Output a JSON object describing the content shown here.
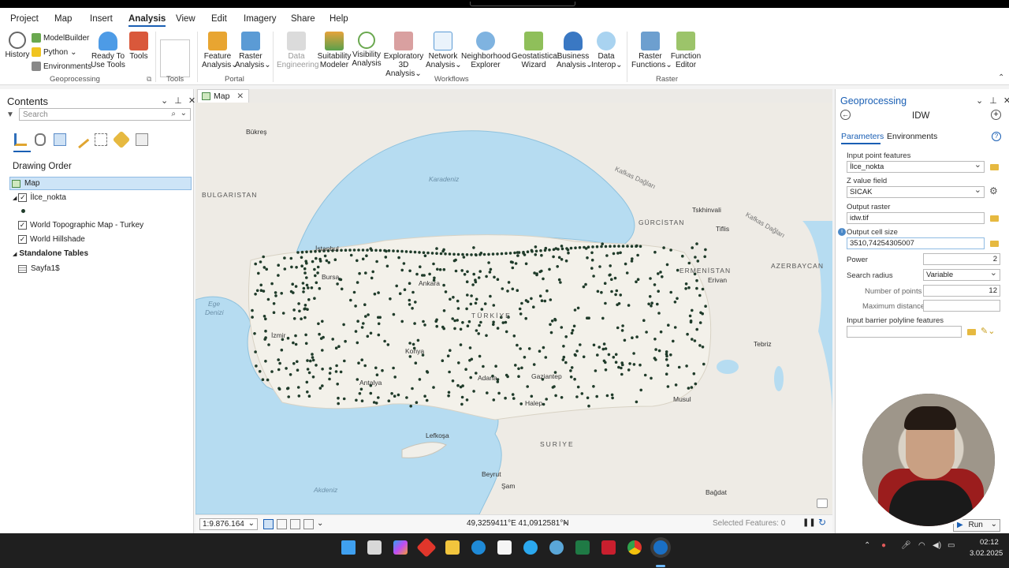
{
  "menu": [
    "Project",
    "Map",
    "Insert",
    "Analysis",
    "View",
    "Edit",
    "Imagery",
    "Share",
    "Help"
  ],
  "ribbon": {
    "geoprocessing": {
      "history": "History",
      "modelbuilder": "ModelBuilder",
      "python": "Python",
      "environments": "Environments",
      "ready_tools_1": "Ready To",
      "ready_tools_2": "Use Tools",
      "tools": "Tools",
      "label": "Geoprocessing"
    },
    "tools_group_label": "Tools",
    "portal": {
      "feature_1": "Feature",
      "feature_2": "Analysis",
      "raster_1": "Raster",
      "raster_2": "Analysis",
      "label": "Portal"
    },
    "workflows": {
      "items": [
        {
          "l1": "Data",
          "l2": "Engineering"
        },
        {
          "l1": "Suitability",
          "l2": "Modeler"
        },
        {
          "l1": "Visibility",
          "l2": "Analysis"
        },
        {
          "l1": "Exploratory",
          "l2": "3D Analysis"
        },
        {
          "l1": "Network",
          "l2": "Analysis"
        },
        {
          "l1": "Neighborhood",
          "l2": "Explorer"
        },
        {
          "l1": "Geostatistical",
          "l2": "Wizard"
        },
        {
          "l1": "Business",
          "l2": "Analysis"
        },
        {
          "l1": "Data",
          "l2": "Interop"
        }
      ],
      "label": "Workflows"
    },
    "raster": {
      "rf_1": "Raster",
      "rf_2": "Functions",
      "fe_1": "Function",
      "fe_2": "Editor",
      "label": "Raster"
    }
  },
  "contents": {
    "title": "Contents",
    "search_placeholder": "Search",
    "drawing_order": "Drawing Order",
    "map": "Map",
    "layer1": "İlce_nokta",
    "layer2": "World Topographic Map - Turkey",
    "layer3": "World Hillshade",
    "standalone": "Standalone Tables",
    "table1": "Sayfa1$"
  },
  "map": {
    "tab": "Map",
    "labels": {
      "bukres": "Bükreş",
      "karadeniz": "Karadeniz",
      "bulgaristan": "BULGARISTAN",
      "kafkas1": "Kafkas Dağları",
      "kafkas2": "Kafkas Dağları",
      "gurcistan": "GÜRCİSTAN",
      "tskhinvali": "Tskhinvali",
      "tiflis": "Tiflis",
      "azerbaycan": "AZERBAYCAN",
      "istanbul": "İstanbul",
      "bursa": "Bursa",
      "ankara": "Ankara",
      "ermenistan": "ERMENİSTAN",
      "erivan": "Erivan",
      "ege1": "Ege",
      "ege2": "Denizi",
      "turkiye": "TÜRKİYE",
      "izmir": "İzmir",
      "konya": "Konya",
      "tebriz": "Tebriz",
      "antalya": "Antalya",
      "adana": "Adana",
      "gaziantep": "Gaziantep",
      "halep": "Halep",
      "musul": "Musul",
      "lefkosa": "Lefkoşa",
      "suriye": "SURİYE",
      "beyrut": "Beyrut",
      "sam": "Şam",
      "akdeniz": "Akdeniz",
      "bagdat": "Bağdat"
    },
    "scale": "1:9.876.164",
    "coords": "49,3259411°E 41,0912581°N",
    "selected": "Selected Features: 0"
  },
  "geoprocessing": {
    "title": "Geoprocessing",
    "tool": "IDW",
    "tab_params": "Parameters",
    "tab_env": "Environments",
    "input_label": "Input point features",
    "input_value": "İlce_nokta",
    "z_label": "Z value field",
    "z_value": "SICAK",
    "out_label": "Output raster",
    "out_value": "idw.tif",
    "cell_label": "Output cell size",
    "cell_value": "3510,74254305007",
    "power_label": "Power",
    "power_value": "2",
    "radius_label": "Search radius",
    "radius_value": "Variable",
    "npts_label": "Number of points",
    "npts_value": "12",
    "maxd_label": "Maximum distance",
    "barrier_label": "Input barrier polyline features",
    "run": "Run"
  },
  "taskbar": {
    "time": "02:12",
    "date": "3.02.2025"
  },
  "colors": {
    "accent": "#1a5fb4",
    "point": "#1f3b2a",
    "sea": "#b9ddf0",
    "land": "#efece6"
  }
}
